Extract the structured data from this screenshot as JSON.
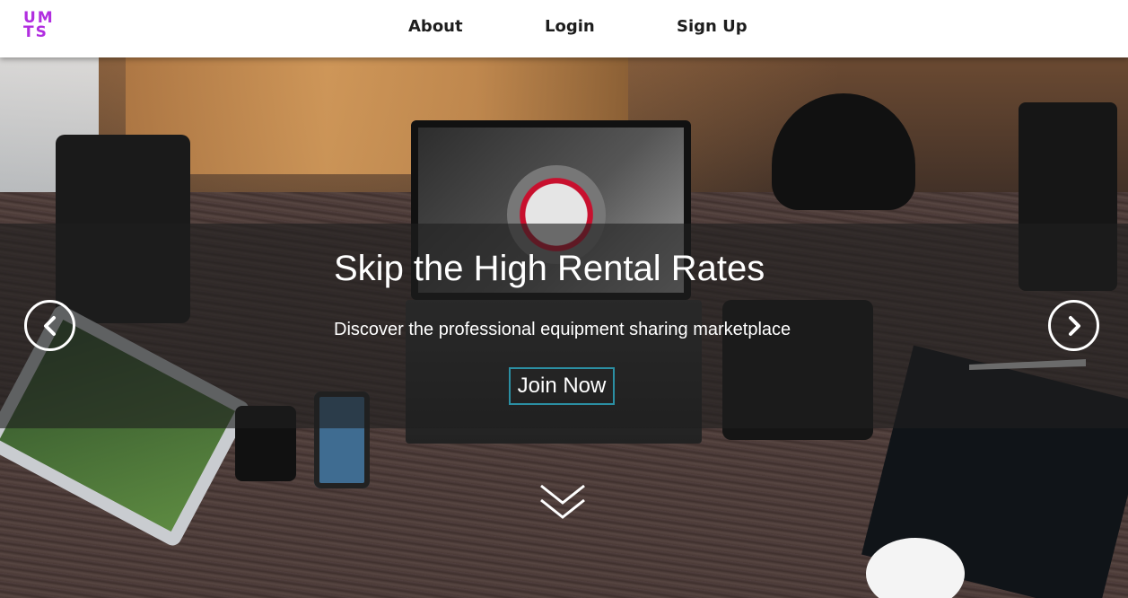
{
  "header": {
    "logo": {
      "line1": "UM",
      "line2": "TS",
      "color": "#b12ee0"
    },
    "nav": [
      {
        "label": "About"
      },
      {
        "label": "Login"
      },
      {
        "label": "Sign Up"
      }
    ]
  },
  "hero": {
    "headline": "Skip the High Rental Rates",
    "subhead": "Discover the professional equipment sharing marketplace",
    "cta_label": "Join Now",
    "cta_border_color": "#2b8fa3",
    "prev_icon": "chevron-left-icon",
    "next_icon": "chevron-right-icon",
    "scroll_icon": "double-chevron-down-icon"
  }
}
